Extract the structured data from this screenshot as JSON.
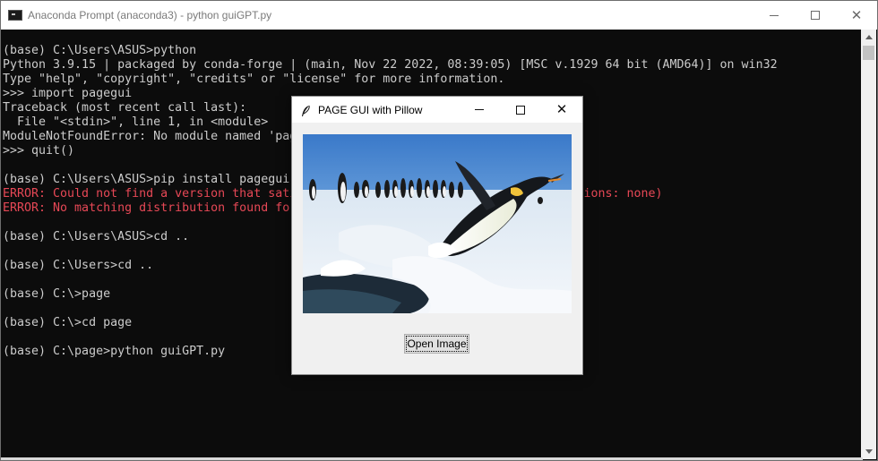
{
  "window": {
    "title": "Anaconda Prompt (anaconda3) - python  guiGPT.py",
    "icon": "console-icon",
    "controls": [
      "minimize-icon",
      "maximize-icon",
      "close-icon"
    ]
  },
  "terminal": {
    "lines": [
      {
        "text": "(base) C:\\Users\\ASUS>python",
        "type": "normal"
      },
      {
        "text": "Python 3.9.15 | packaged by conda-forge | (main, Nov 22 2022, 08:39:05) [MSC v.1929 64 bit (AMD64)] on win32",
        "type": "normal"
      },
      {
        "text": "Type \"help\", \"copyright\", \"credits\" or \"license\" for more information.",
        "type": "normal"
      },
      {
        "text": ">>> import pagegui",
        "type": "normal"
      },
      {
        "text": "Traceback (most recent call last):",
        "type": "normal"
      },
      {
        "text": "  File \"<stdin>\", line 1, in <module>",
        "type": "normal"
      },
      {
        "text": "ModuleNotFoundError: No module named 'pagegui'",
        "type": "normal"
      },
      {
        "text": ">>> quit()",
        "type": "normal"
      },
      {
        "text": "",
        "type": "normal"
      },
      {
        "text": "(base) C:\\Users\\ASUS>pip install pagegui",
        "type": "normal"
      },
      {
        "text": "ERROR: Could not find a version that satisfies the requirement pagegui (from versions: none)",
        "type": "error"
      },
      {
        "text": "ERROR: No matching distribution found for pagegui",
        "type": "error"
      },
      {
        "text": "",
        "type": "normal"
      },
      {
        "text": "(base) C:\\Users\\ASUS>cd ..",
        "type": "normal"
      },
      {
        "text": "",
        "type": "normal"
      },
      {
        "text": "(base) C:\\Users>cd ..",
        "type": "normal"
      },
      {
        "text": "",
        "type": "normal"
      },
      {
        "text": "(base) C:\\>page",
        "type": "normal"
      },
      {
        "text": "",
        "type": "normal"
      },
      {
        "text": "(base) C:\\>cd page",
        "type": "normal"
      },
      {
        "text": "",
        "type": "normal"
      },
      {
        "text": "(base) C:\\page>python guiGPT.py",
        "type": "normal"
      }
    ]
  },
  "dialog": {
    "title": "PAGE GUI with Pillow",
    "icon": "feather-icon",
    "open_button_label": "Open Image",
    "image": "penguin-photo"
  },
  "colors": {
    "terminal_bg": "#0c0c0c",
    "terminal_fg": "#cccccc",
    "error_fg": "#e74856",
    "dialog_bg": "#f0f0f0"
  }
}
